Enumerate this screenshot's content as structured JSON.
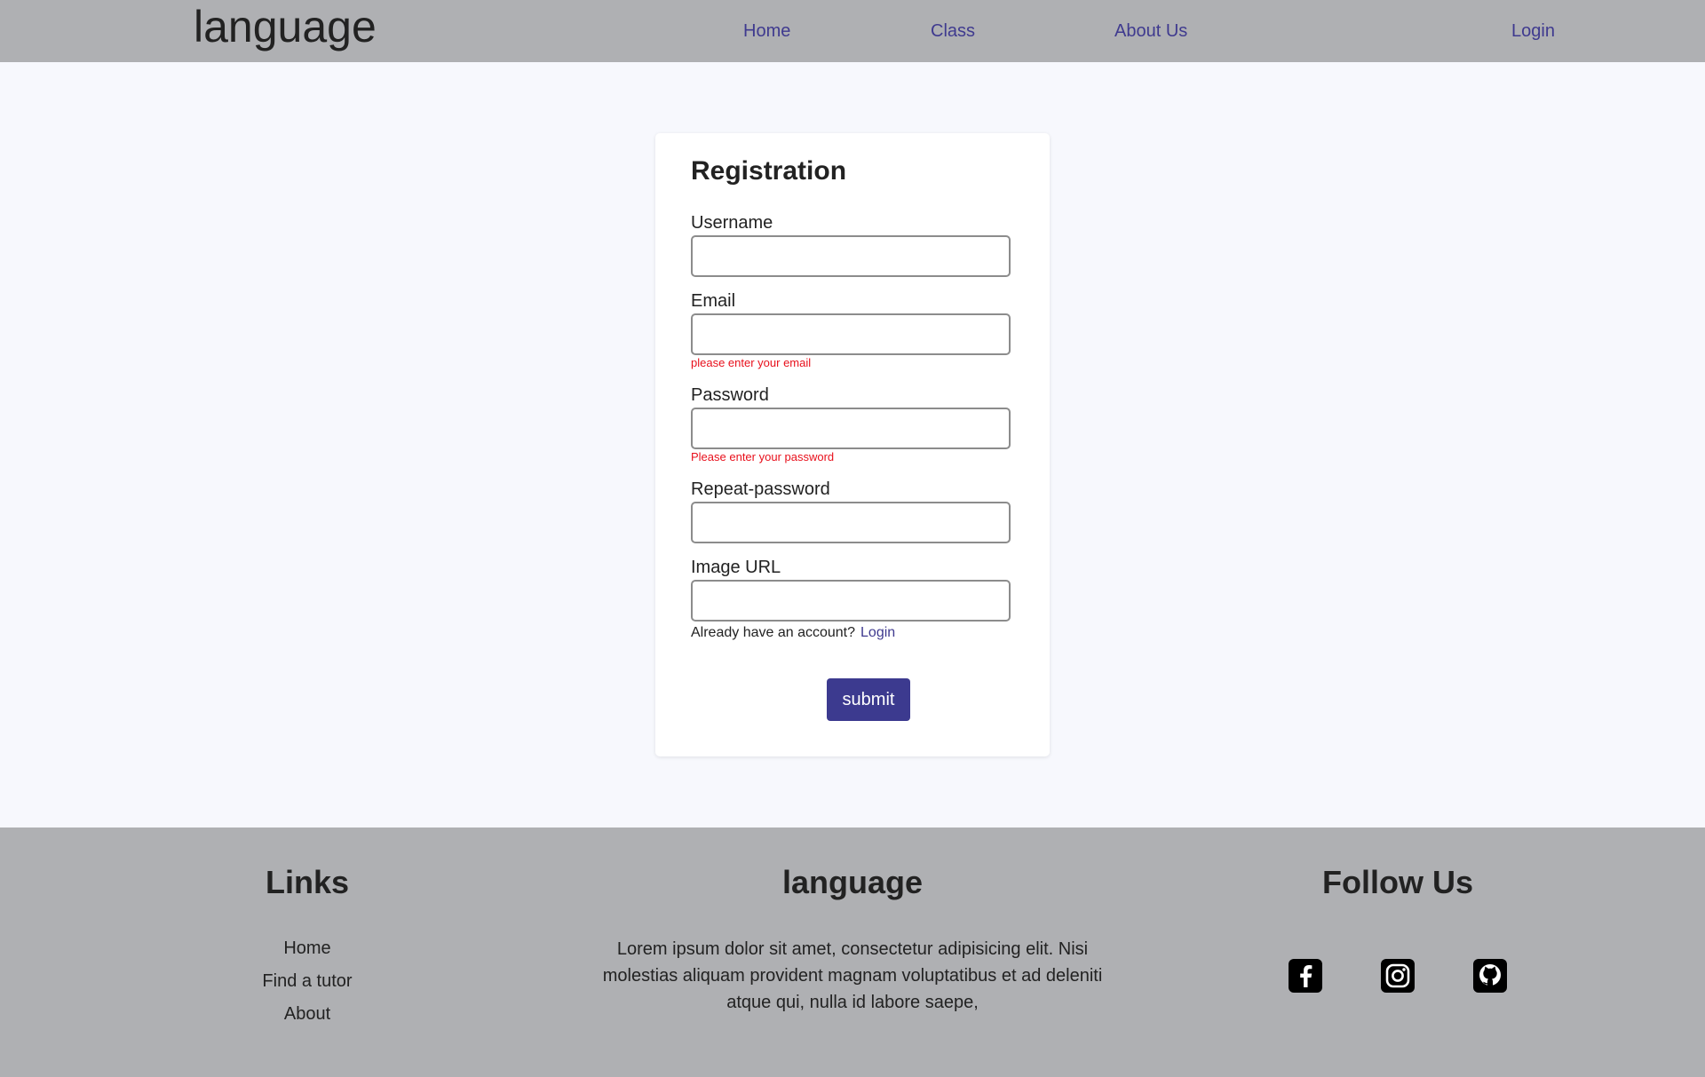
{
  "header": {
    "brand": "language",
    "nav": {
      "home": "Home",
      "class": "Class",
      "about": "About Us",
      "login": "Login"
    }
  },
  "form": {
    "title": "Registration",
    "fields": {
      "username": {
        "label": "Username",
        "value": "",
        "error": ""
      },
      "email": {
        "label": "Email",
        "value": "",
        "error": "please enter your email"
      },
      "password": {
        "label": "Password",
        "value": "",
        "error": "Please enter your password"
      },
      "repeat_password": {
        "label": "Repeat-password",
        "value": ""
      },
      "image_url": {
        "label": "Image URL",
        "value": ""
      }
    },
    "account_prompt": "Already have an account?",
    "account_login": "Login",
    "submit_label": "submit"
  },
  "footer": {
    "links_heading": "Links",
    "links": [
      "Home",
      "Find a tutor",
      "About"
    ],
    "brand_heading": "language",
    "brand_text": "Lorem ipsum dolor sit amet, consectetur adipisicing elit. Nisi molestias aliquam provident magnam voluptatibus et ad deleniti atque qui, nulla id labore saepe,",
    "follow_heading": "Follow Us",
    "social_icons": [
      "facebook-icon",
      "instagram-icon",
      "github-icon"
    ]
  },
  "colors": {
    "header_bg": "#afb0b3",
    "page_bg": "#f7f8fd",
    "accent": "#3c3a8f",
    "error": "#e8101c"
  }
}
